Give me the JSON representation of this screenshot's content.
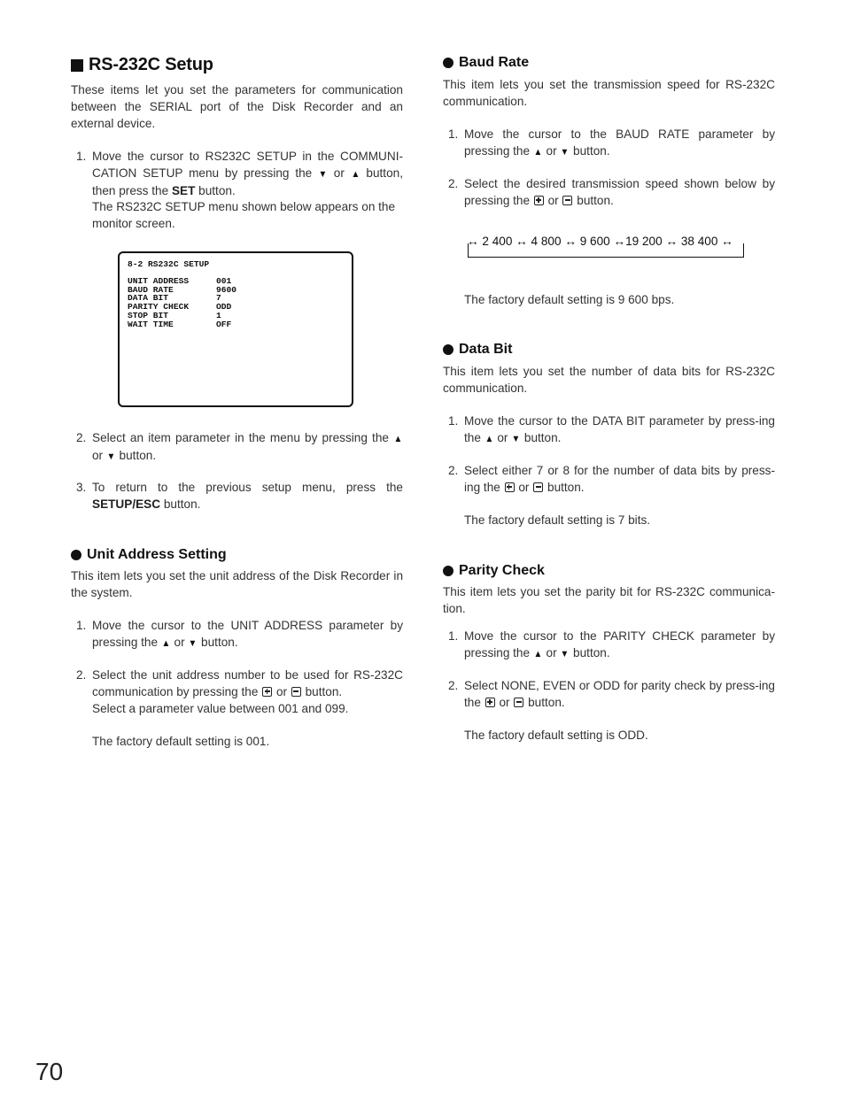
{
  "page_number": "70",
  "rs232c": {
    "title": "RS-232C Setup",
    "intro": "These items let you set the parameters for communication between the SERIAL port of the Disk Recorder and an external device.",
    "steps": [
      {
        "num": "1.",
        "parts": [
          "Move the cursor to RS232C SETUP in the COMMUNI-CATION SETUP menu by pressing the ",
          " or ",
          " button, then press the ",
          "SET",
          " button."
        ],
        "note": "The RS232C SETUP menu shown below appears on the monitor screen."
      },
      {
        "num": "2.",
        "parts": [
          "Select an item parameter in the menu by pressing the ",
          " or ",
          " button."
        ]
      },
      {
        "num": "3.",
        "parts": [
          "To return to the previous setup menu, press the ",
          "SETUP/ESC",
          " button."
        ]
      }
    ],
    "screen": {
      "title": "8-2 RS232C SETUP",
      "rows": [
        {
          "label": "UNIT ADDRESS",
          "value": "001"
        },
        {
          "label": "BAUD RATE",
          "value": "9600"
        },
        {
          "label": "DATA BIT",
          "value": "7"
        },
        {
          "label": "PARITY CHECK",
          "value": "ODD"
        },
        {
          "label": "STOP BIT",
          "value": "1"
        },
        {
          "label": "WAIT TIME",
          "value": "OFF"
        }
      ]
    }
  },
  "unit_address": {
    "title": "Unit Address Setting",
    "intro": "This item lets you set the unit address of the Disk Recorder in the system.",
    "step1": {
      "num": "1.",
      "text_a": "Move the cursor to the UNIT ADDRESS parameter by pressing the ",
      "text_b": " or ",
      "text_c": " button."
    },
    "step2": {
      "num": "2.",
      "text_a": "Select the unit address number to be used for RS-232C communication by pressing the ",
      "text_b": " or ",
      "text_c": " button.",
      "line2": "Select a parameter value between 001 and 099."
    },
    "default": "The factory default setting is 001."
  },
  "baud_rate": {
    "title": "Baud Rate",
    "intro": "This item lets you set the transmission speed for RS-232C communication.",
    "step1": {
      "num": "1.",
      "text_a": "Move the cursor to the BAUD RATE parameter by pressing the ",
      "text_b": " or ",
      "text_c": " button."
    },
    "step2": {
      "num": "2.",
      "text_a": "Select the desired transmission speed shown below by pressing the ",
      "text_b": " or ",
      "text_c": " button."
    },
    "cycle": "↔ 2 400 ↔ 4 800 ↔ 9 600 ↔19 200 ↔ 38 400 ↔",
    "default": "The factory default setting is 9 600 bps."
  },
  "data_bit": {
    "title": "Data Bit",
    "intro": "This item lets you set the number of data bits for RS-232C communication.",
    "step1": {
      "num": "1.",
      "text_a": "Move the cursor to the DATA BIT parameter by press-ing the ",
      "text_b": " or ",
      "text_c": " button."
    },
    "step2": {
      "num": "2.",
      "text_a": "Select either 7 or 8 for the number of data bits by press-ing the ",
      "text_b": " or ",
      "text_c": " button."
    },
    "default": "The factory default setting is 7 bits."
  },
  "parity_check": {
    "title": "Parity Check",
    "intro": "This item lets you set the parity bit for RS-232C communica-tion.",
    "step1": {
      "num": "1.",
      "text_a": "Move the cursor to the PARITY CHECK parameter by pressing the ",
      "text_b": " or ",
      "text_c": " button."
    },
    "step2": {
      "num": "2.",
      "text_a": "Select NONE, EVEN or ODD for parity check by press-ing the ",
      "text_b": " or ",
      "text_c": " button."
    },
    "default": "The factory default setting is ODD."
  },
  "icons": {
    "up": "▲",
    "down": "▼"
  }
}
